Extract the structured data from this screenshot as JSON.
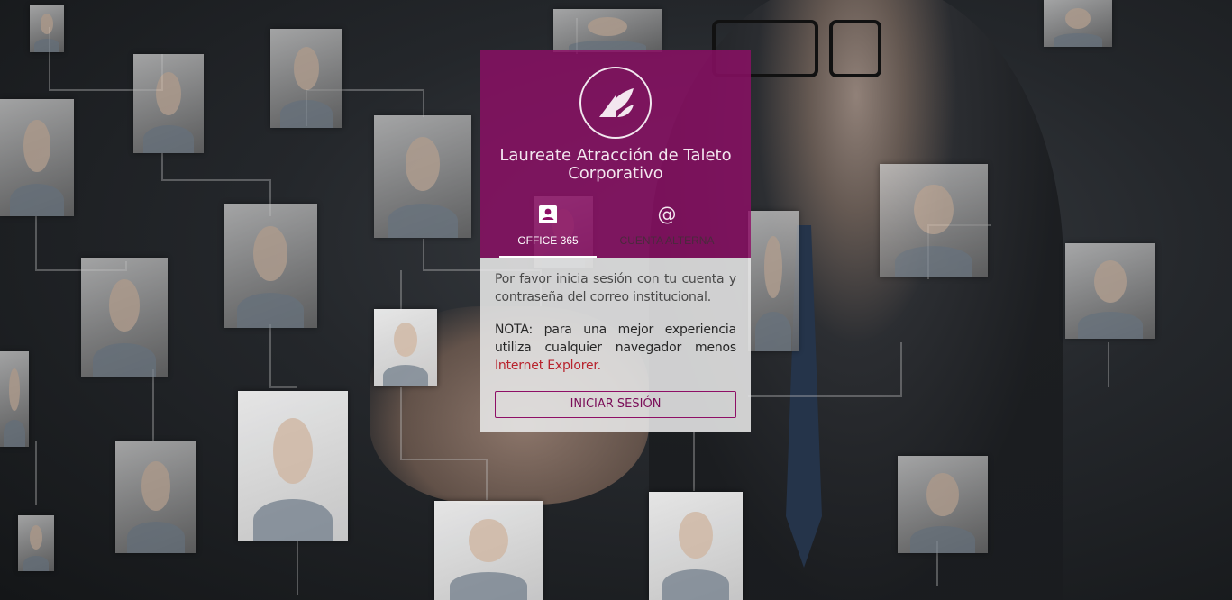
{
  "app": {
    "title": "Laureate Atracción de Taleto Corporativo",
    "accent_color": "#8e0f66",
    "logo_icon": "laureate-leaf-logo"
  },
  "tabs": [
    {
      "label": "OFFICE 365",
      "icon": "contact-card-icon",
      "active": true
    },
    {
      "label": "CUENTA ALTERNA",
      "icon": "at-sign-icon",
      "active": false
    }
  ],
  "message": "Por favor inicia sesión con tu cuenta y contraseña del correo institucional.",
  "note": {
    "text": "NOTA: para una mejor experiencia utiliza cualquier navegador menos ",
    "highlight": "Internet Explorer",
    "end": ".",
    "highlight_color": "#b8232d"
  },
  "login_button": "INICIAR SESIÓN"
}
